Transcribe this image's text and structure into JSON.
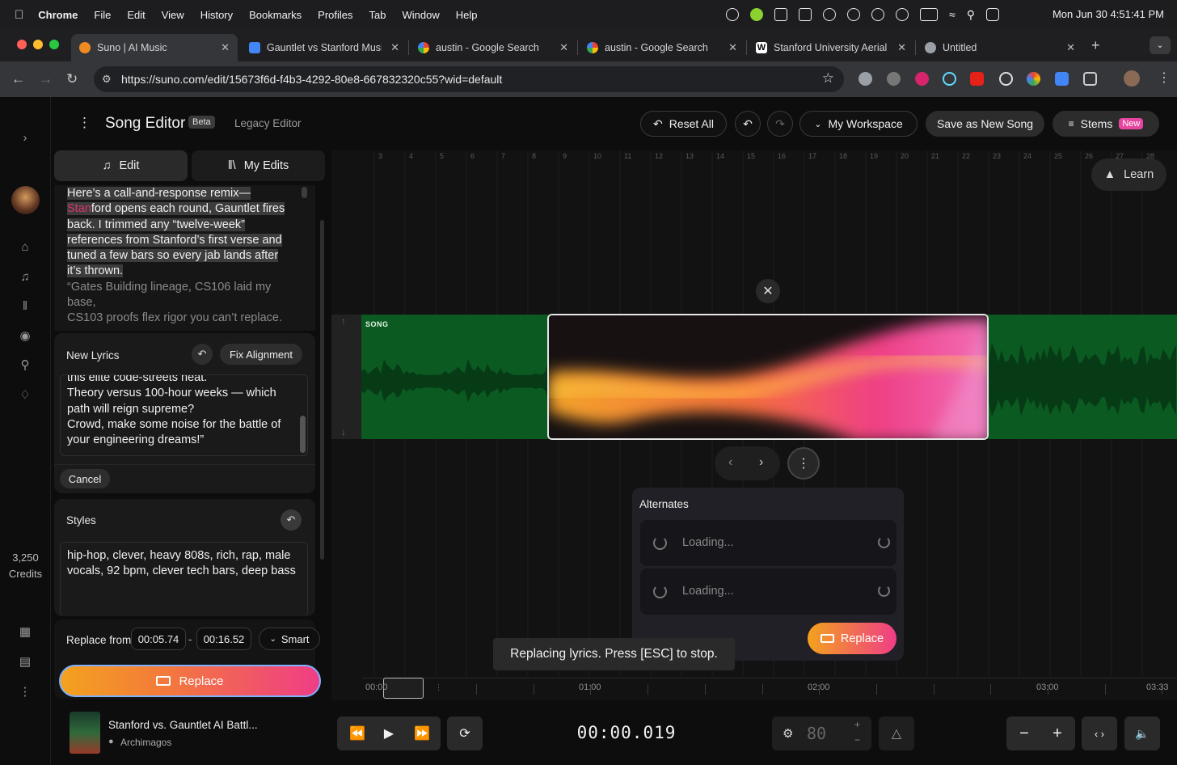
{
  "menubar": {
    "app": "Chrome",
    "items": [
      "File",
      "Edit",
      "View",
      "History",
      "Bookmarks",
      "Profiles",
      "Tab",
      "Window",
      "Help"
    ],
    "clock": "Mon Jun 30  4:51:41 PM"
  },
  "tabs": [
    {
      "label": "Suno | AI Music",
      "active": true,
      "color": "#f08a24"
    },
    {
      "label": "Gauntlet vs Stanford Music",
      "active": false,
      "color": "#4285f4"
    },
    {
      "label": "austin - Google Search",
      "active": false,
      "color": "#ea4335"
    },
    {
      "label": "austin - Google Search",
      "active": false,
      "color": "#ea4335"
    },
    {
      "label": "Stanford University Aerial",
      "active": false,
      "color": "#ffffff"
    },
    {
      "label": "Untitled",
      "active": false,
      "color": "#9aa0a6"
    }
  ],
  "address": {
    "url": "https://suno.com/edit/15673f6d-f4b3-4292-80e8-667832320c55?wid=default"
  },
  "rail": {
    "credits_value": "3,250",
    "credits_label": "Credits"
  },
  "header": {
    "title": "Song Editor",
    "beta": "Beta",
    "legacy": "Legacy Editor",
    "reset_all": "Reset All",
    "workspace": "My Workspace",
    "save_new": "Save as New Song",
    "stems": "Stems",
    "stems_badge": "New"
  },
  "panel": {
    "tab_edit": "Edit",
    "tab_myedits": "My Edits",
    "lyrics_intro_1": "Here’s a call-and-response remix—",
    "lyrics_intro_2a": "Stan",
    "lyrics_intro_2b": "ford opens each round, Gauntlet fires",
    "lyrics_intro_3": "back. I trimmed any “twelve-week”",
    "lyrics_intro_4": "references from Stanford’s first verse and",
    "lyrics_intro_5": "tuned a few bars so every jab lands after",
    "lyrics_intro_6": "it’s thrown.",
    "lyrics_dim_1": "“Gates Building lineage, CS106 laid my",
    "lyrics_dim_2": "base,",
    "lyrics_dim_3": "CS103 proofs flex rigor you can’t replace.",
    "new_lyrics_label": "New Lyrics",
    "fix_alignment": "Fix Alignment",
    "new_lyrics_1": "this elite code-streets heat.",
    "new_lyrics_2": "Theory versus 100-hour weeks — which",
    "new_lyrics_3": "path will reign supreme?",
    "new_lyrics_4": "Crowd, make some noise for the battle of",
    "new_lyrics_5": "your engineering dreams!”",
    "cancel": "Cancel",
    "styles_label": "Styles",
    "styles_text": "hip-hop, clever, heavy 808s, rich, rap, male vocals, 92 bpm, clever tech bars, deep bass",
    "replace_from": "Replace from",
    "from_time": "00:05.74",
    "dash": "-",
    "to_time": "00:16.52",
    "mode": "Smart",
    "replace": "Replace"
  },
  "timeline": {
    "learn": "Learn",
    "track_label": "SONG",
    "ruler_numbers": [
      "3",
      "4",
      "5",
      "6",
      "7",
      "8",
      "9",
      "10",
      "11",
      "12",
      "13",
      "14",
      "15",
      "16",
      "17",
      "18",
      "19",
      "20",
      "21",
      "22",
      "23",
      "24",
      "25",
      "26",
      "27",
      "28"
    ],
    "alternates_title": "Alternates",
    "loading_1": "Loading...",
    "loading_2": "Loading...",
    "alt_replace": "Replace",
    "toast": "Replacing lyrics. Press [ESC] to stop.",
    "bottom_labels": [
      "00:00",
      "01:00",
      "02:00",
      "03:00",
      "03:33"
    ]
  },
  "transport": {
    "song_title": "Stanford vs. Gauntlet AI Battl...",
    "artist": "Archimagos",
    "timecode": "00:00.019",
    "bpm": "80"
  }
}
